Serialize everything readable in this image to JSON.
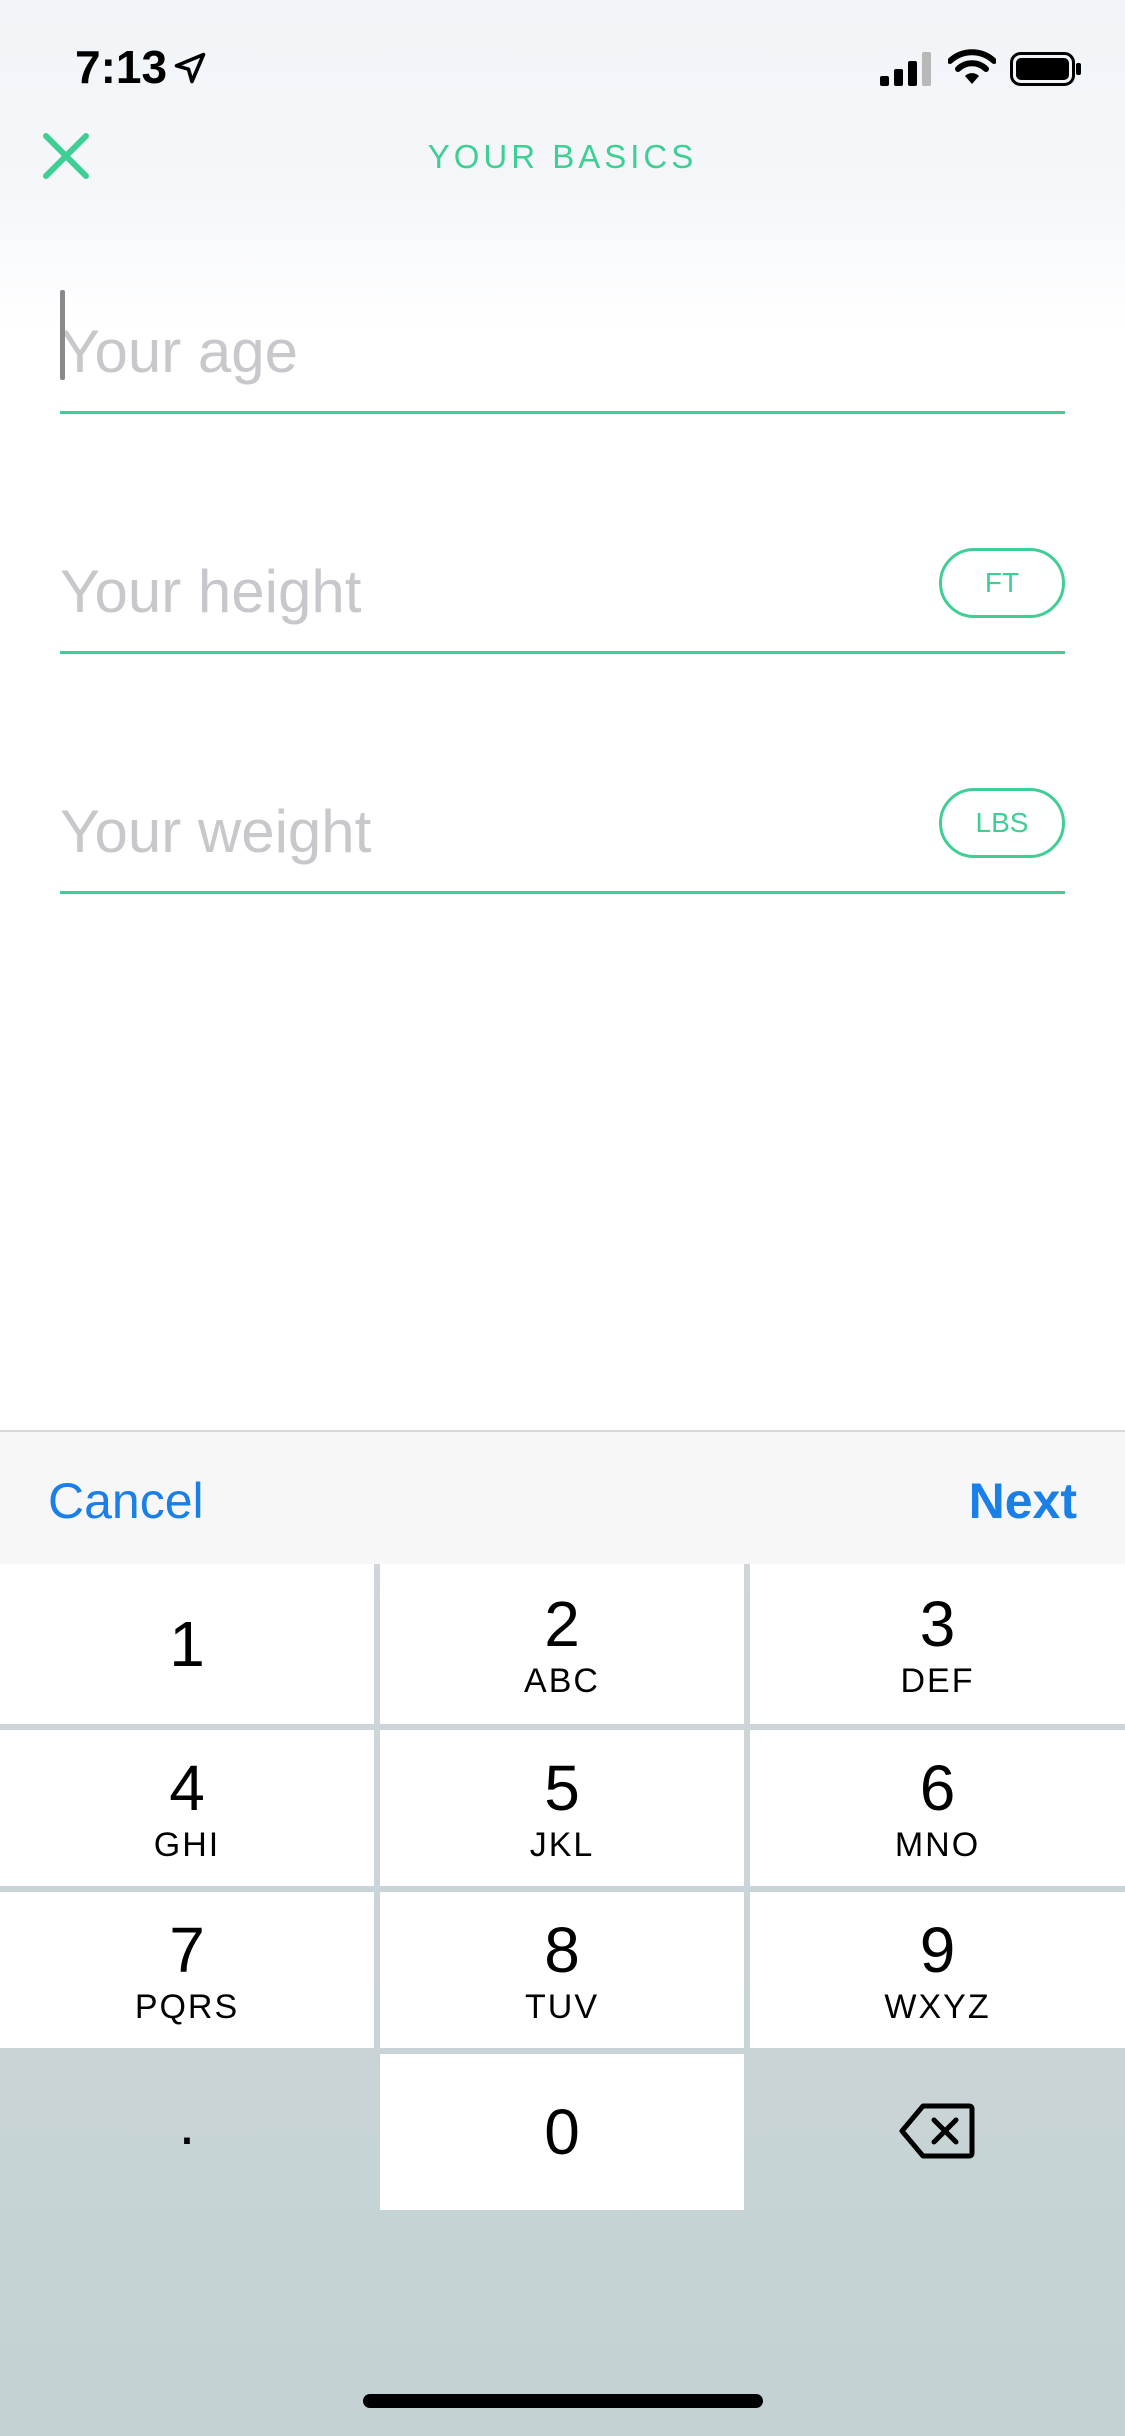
{
  "status_bar": {
    "time": "7:13"
  },
  "nav": {
    "title": "YOUR BASICS"
  },
  "fields": {
    "age": {
      "placeholder": "Your age",
      "value": ""
    },
    "height": {
      "placeholder": "Your height",
      "value": "",
      "unit": "FT"
    },
    "weight": {
      "placeholder": "Your weight",
      "value": "",
      "unit": "LBS"
    }
  },
  "toolbar": {
    "cancel_label": "Cancel",
    "next_label": "Next"
  },
  "keypad": {
    "keys": [
      {
        "num": "1",
        "letters": ""
      },
      {
        "num": "2",
        "letters": "ABC"
      },
      {
        "num": "3",
        "letters": "DEF"
      },
      {
        "num": "4",
        "letters": "GHI"
      },
      {
        "num": "5",
        "letters": "JKL"
      },
      {
        "num": "6",
        "letters": "MNO"
      },
      {
        "num": "7",
        "letters": "PQRS"
      },
      {
        "num": "8",
        "letters": "TUV"
      },
      {
        "num": "9",
        "letters": "WXYZ"
      },
      {
        "num": ".",
        "letters": ""
      },
      {
        "num": "0",
        "letters": ""
      }
    ]
  },
  "colors": {
    "accent": "#3fcf94",
    "ios_blue": "#1a7fe6"
  }
}
